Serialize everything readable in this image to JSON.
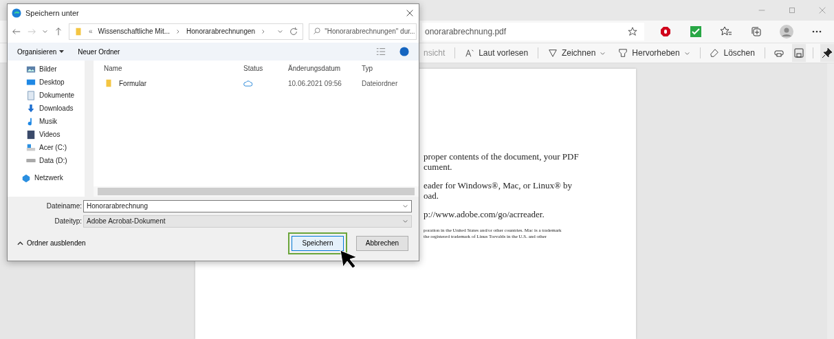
{
  "browser": {
    "address": "onorarabrechnung.pdf",
    "toolbar": [
      {
        "kind": "cut",
        "label": "nsicht"
      },
      {
        "kind": "read",
        "label": "Laut vorlesen"
      },
      {
        "kind": "draw",
        "label": "Zeichnen"
      },
      {
        "kind": "highlight",
        "label": "Hervorheben"
      },
      {
        "kind": "erase",
        "label": "Löschen"
      }
    ],
    "document": {
      "paragraphs": [
        {
          "kind": "body",
          "lines": [
            "proper contents of the document, your PDF",
            "cument."
          ]
        },
        {
          "kind": "body",
          "lines": [
            "eader for Windows®, Mac, or Linux® by",
            "oad."
          ]
        },
        {
          "kind": "body",
          "lines": [
            "p://www.adobe.com/go/acrreader."
          ]
        },
        {
          "kind": "fine",
          "lines": [
            "poration in the United States and/or other countries. Mac is a trademark",
            "the registered trademark of Linus Torvalds in the U.S. and other"
          ]
        }
      ]
    }
  },
  "dialog": {
    "title": "Speichern unter",
    "breadcrumb": [
      "«",
      "Wissenschaftliche Mit...",
      "Honorarabrechnungen"
    ],
    "search": {
      "placeholder": "\"Honorarabrechnungen\" dur..."
    },
    "commands": [
      "Organisieren",
      "Neuer Ordner"
    ],
    "sidebar": {
      "items": [
        {
          "kind": "pictures",
          "label": "Bilder"
        },
        {
          "kind": "desktop",
          "label": "Desktop"
        },
        {
          "kind": "documents",
          "label": "Dokumente"
        },
        {
          "kind": "downloads",
          "label": "Downloads"
        },
        {
          "kind": "music",
          "label": "Musik"
        },
        {
          "kind": "videos",
          "label": "Videos"
        },
        {
          "kind": "drive",
          "label": "Acer (C:)"
        },
        {
          "kind": "disk",
          "label": "Data (D:)"
        },
        {
          "kind": "network",
          "label": "Netzwerk"
        }
      ]
    },
    "table": {
      "columns": [
        "Name",
        "Status",
        "Änderungsdatum",
        "Typ"
      ],
      "rows": [
        {
          "name": "Formular",
          "in_cloud": true,
          "date": "10.06.2021 09:56",
          "type": "Dateiordner"
        }
      ]
    },
    "filename": {
      "label": "Dateiname:",
      "value": "Honorarabrechnung"
    },
    "filetype": {
      "label": "Dateityp:",
      "value": "Adobe Acrobat-Dokument"
    },
    "toggle": "Ordner ausblenden",
    "buttons": [
      {
        "label": "Speichern",
        "focused": true
      },
      {
        "label": "Abbrechen",
        "focused": false
      }
    ]
  }
}
